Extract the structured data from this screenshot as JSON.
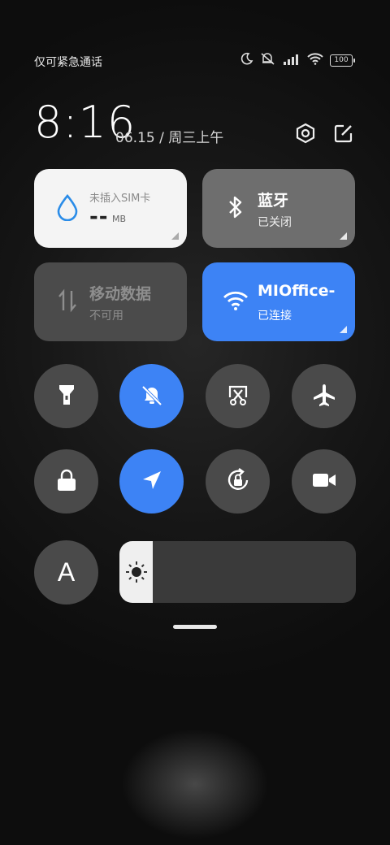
{
  "status_bar": {
    "carrier_text": "仅可紧急通话",
    "battery_level": "100",
    "icons": [
      "moon-icon",
      "mute-icon",
      "signal-icon",
      "wifi-icon",
      "battery-icon"
    ]
  },
  "header": {
    "time": "8:16",
    "date": "06.15 / 周三上午",
    "icons": [
      "settings-icon",
      "edit-icon"
    ]
  },
  "tiles": {
    "data": {
      "label": "未插入SIM卡",
      "value": "--",
      "unit": "MB"
    },
    "bluetooth": {
      "title": "蓝牙",
      "status": "已关闭"
    },
    "mobile_data": {
      "title": "移动数据",
      "status": "不可用"
    },
    "wifi": {
      "title": "MIOffice-",
      "status": "已连接"
    }
  },
  "toggles": [
    {
      "name": "flashlight",
      "active": false
    },
    {
      "name": "mute",
      "active": true
    },
    {
      "name": "screenshot",
      "active": false
    },
    {
      "name": "airplane",
      "active": false
    },
    {
      "name": "lock-screen",
      "active": false
    },
    {
      "name": "location",
      "active": true
    },
    {
      "name": "auto-rotate",
      "active": false
    },
    {
      "name": "screen-record",
      "active": false
    }
  ],
  "font_size_button": {
    "label": "A"
  },
  "brightness": {
    "level_percent": 14
  },
  "colors": {
    "accent": "#3d83f5",
    "tile_inactive": "#6e6e6e",
    "tile_light": "#f4f4f4"
  }
}
